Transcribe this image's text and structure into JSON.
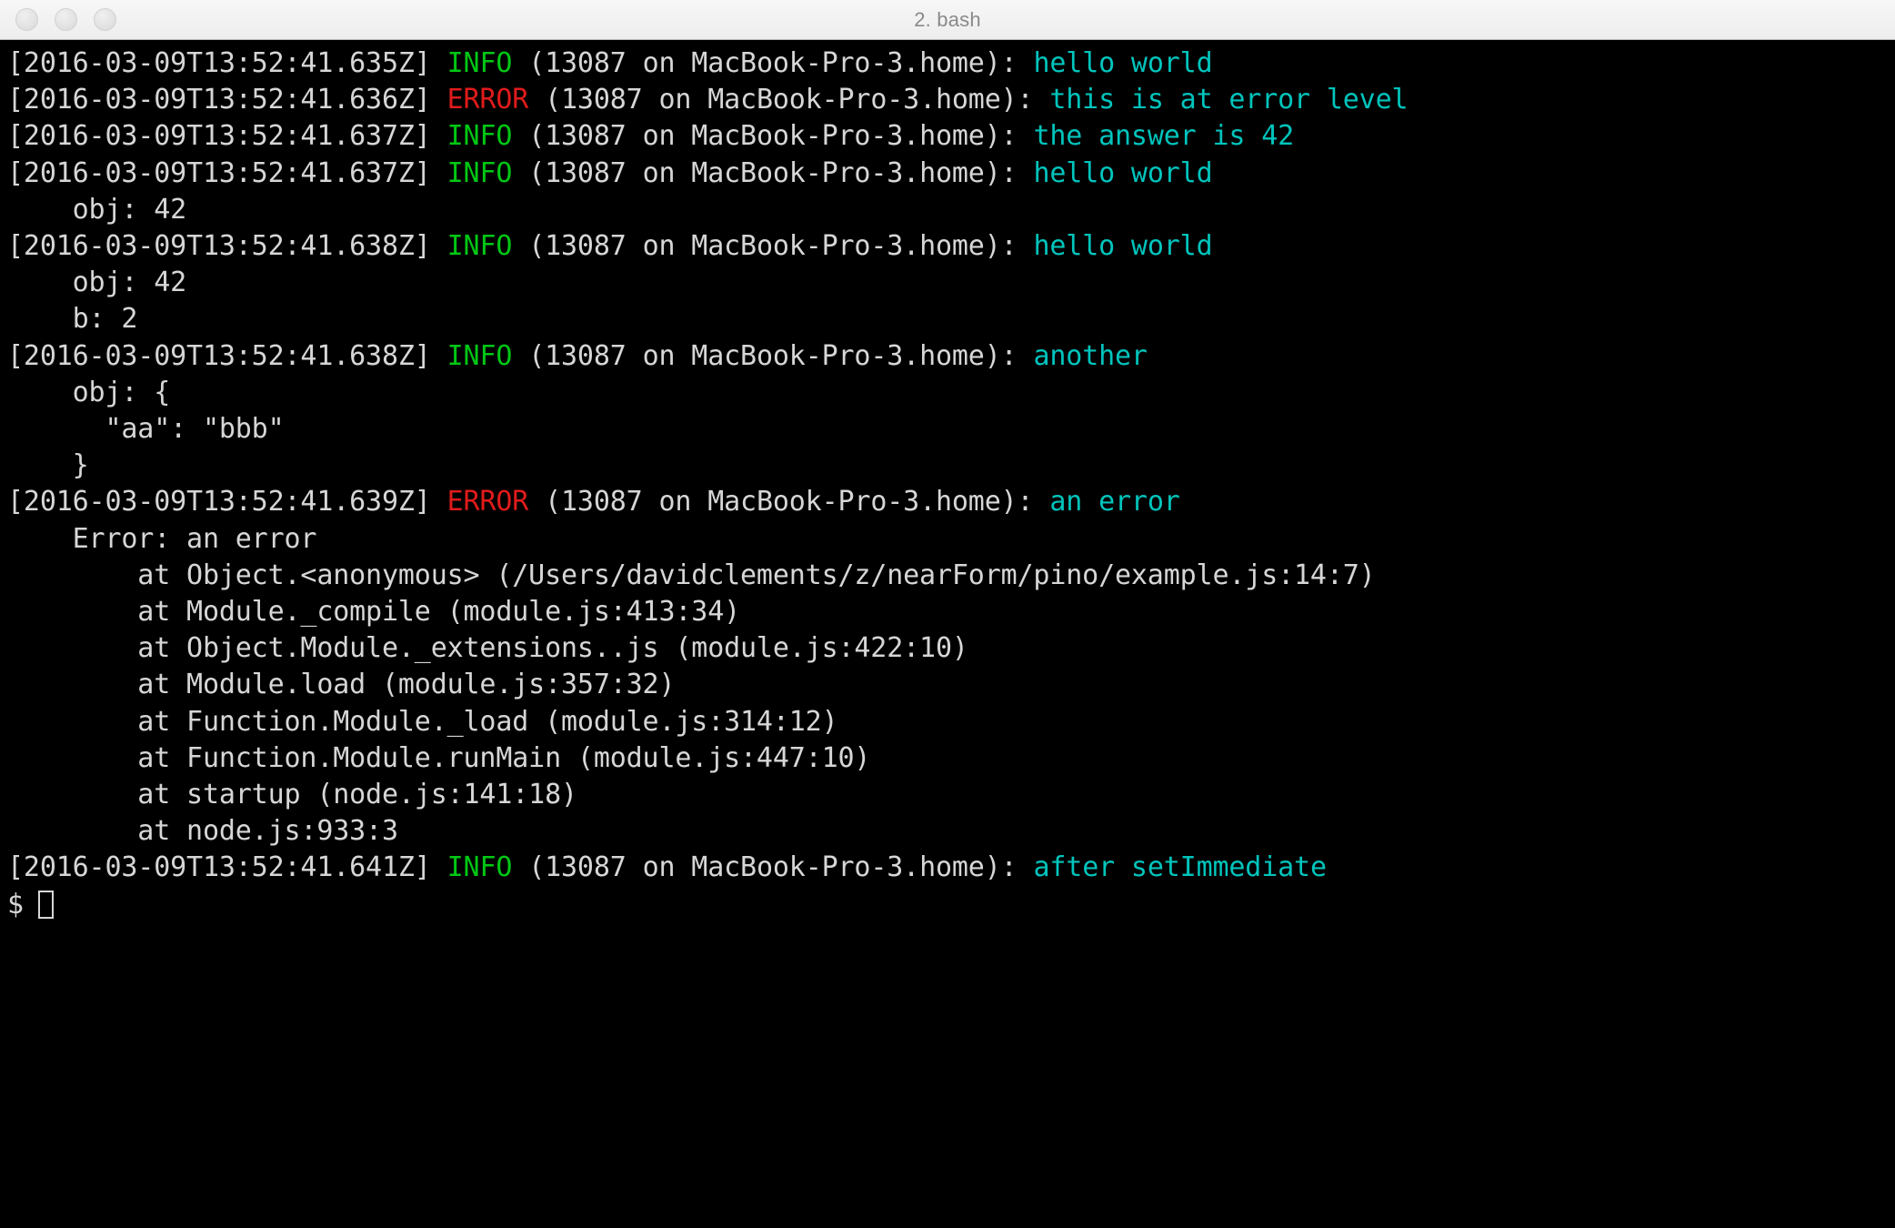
{
  "window": {
    "title": "2. bash",
    "traffic_lights": [
      {
        "name": "close-button",
        "color": "#e3e3e3"
      },
      {
        "name": "minimize-button",
        "color": "#e3e3e3"
      },
      {
        "name": "zoom-button",
        "color": "#e3e3e3"
      }
    ],
    "titlebar_bg": "#f0f0f0",
    "terminal_bg": "#000000"
  },
  "colors": {
    "text": "#d6d6d6",
    "info": "#00c814",
    "error": "#e01b1b",
    "message": "#00c4bc"
  },
  "terminal": {
    "prompt_symbol": "$",
    "lines": [
      {
        "type": "log",
        "time": "[2016-03-09T13:52:41.635Z]",
        "level": "INFO",
        "level_class": "tok-info",
        "meta": " (13087 on MacBook-Pro-3.home): ",
        "message": "hello world"
      },
      {
        "type": "log",
        "time": "[2016-03-09T13:52:41.636Z]",
        "level": "ERROR",
        "level_class": "tok-error",
        "meta": " (13087 on MacBook-Pro-3.home): ",
        "message": "this is at error level"
      },
      {
        "type": "log",
        "time": "[2016-03-09T13:52:41.637Z]",
        "level": "INFO",
        "level_class": "tok-info",
        "meta": " (13087 on MacBook-Pro-3.home): ",
        "message": "the answer is 42"
      },
      {
        "type": "log",
        "time": "[2016-03-09T13:52:41.637Z]",
        "level": "INFO",
        "level_class": "tok-info",
        "meta": " (13087 on MacBook-Pro-3.home): ",
        "message": "hello world"
      },
      {
        "type": "plain",
        "text": "    obj: 42"
      },
      {
        "type": "log",
        "time": "[2016-03-09T13:52:41.638Z]",
        "level": "INFO",
        "level_class": "tok-info",
        "meta": " (13087 on MacBook-Pro-3.home): ",
        "message": "hello world"
      },
      {
        "type": "plain",
        "text": "    obj: 42"
      },
      {
        "type": "plain",
        "text": "    b: 2"
      },
      {
        "type": "log",
        "time": "[2016-03-09T13:52:41.638Z]",
        "level": "INFO",
        "level_class": "tok-info",
        "meta": " (13087 on MacBook-Pro-3.home): ",
        "message": "another"
      },
      {
        "type": "plain",
        "text": "    obj: {"
      },
      {
        "type": "plain",
        "text": "      \"aa\": \"bbb\""
      },
      {
        "type": "plain",
        "text": "    }"
      },
      {
        "type": "log",
        "time": "[2016-03-09T13:52:41.639Z]",
        "level": "ERROR",
        "level_class": "tok-error",
        "meta": " (13087 on MacBook-Pro-3.home): ",
        "message": "an error"
      },
      {
        "type": "plain",
        "text": "    Error: an error"
      },
      {
        "type": "plain",
        "text": "        at Object.<anonymous> (/Users/davidclements/z/nearForm/pino/example.js:14:7)"
      },
      {
        "type": "plain",
        "text": "        at Module._compile (module.js:413:34)"
      },
      {
        "type": "plain",
        "text": "        at Object.Module._extensions..js (module.js:422:10)"
      },
      {
        "type": "plain",
        "text": "        at Module.load (module.js:357:32)"
      },
      {
        "type": "plain",
        "text": "        at Function.Module._load (module.js:314:12)"
      },
      {
        "type": "plain",
        "text": "        at Function.Module.runMain (module.js:447:10)"
      },
      {
        "type": "plain",
        "text": "        at startup (node.js:141:18)"
      },
      {
        "type": "plain",
        "text": "        at node.js:933:3"
      },
      {
        "type": "log",
        "time": "[2016-03-09T13:52:41.641Z]",
        "level": "INFO",
        "level_class": "tok-info",
        "meta": " (13087 on MacBook-Pro-3.home): ",
        "message": "after setImmediate"
      }
    ]
  }
}
